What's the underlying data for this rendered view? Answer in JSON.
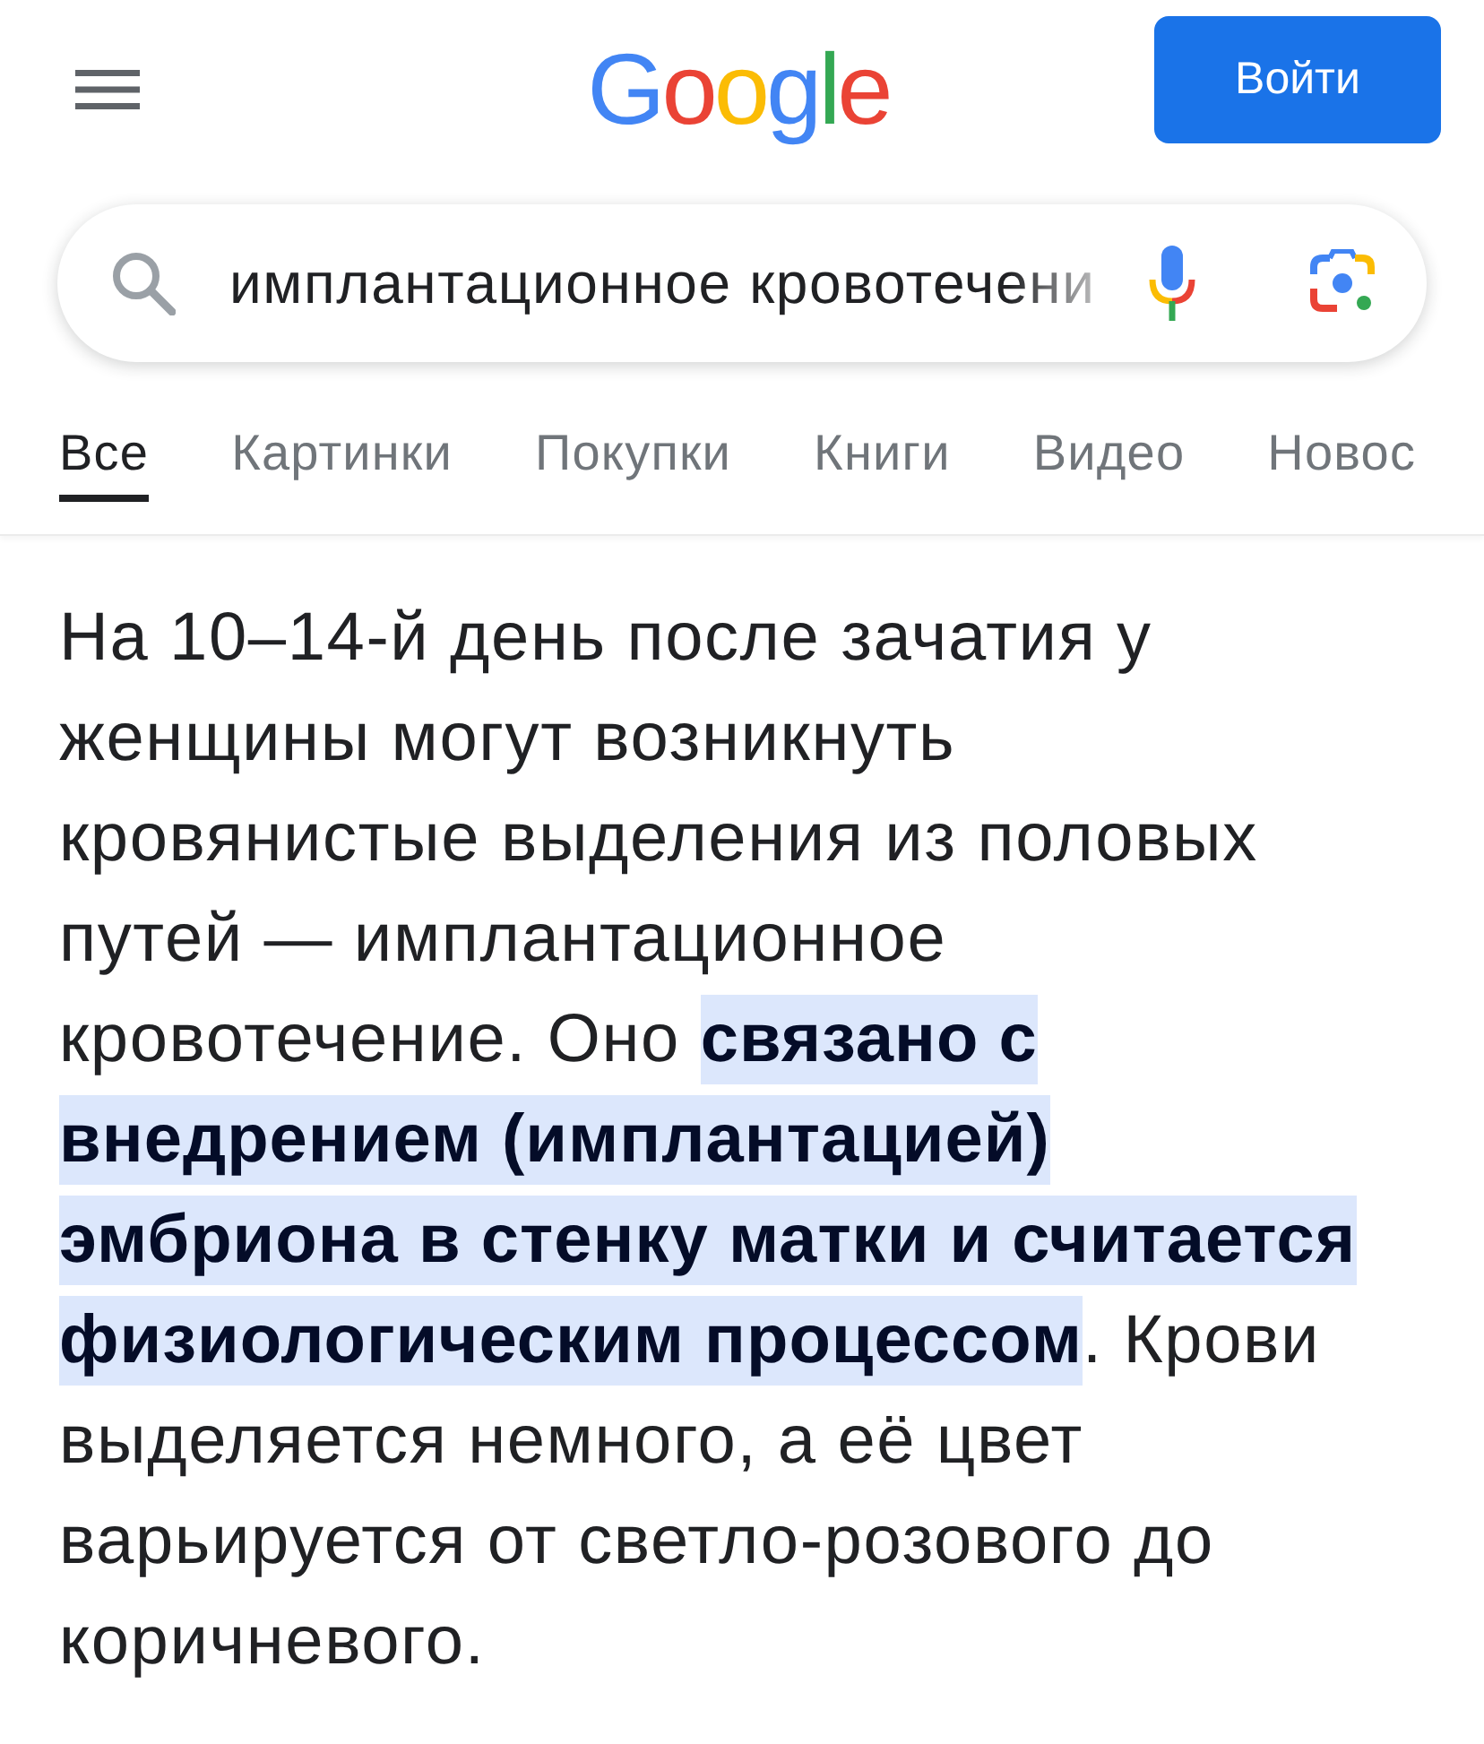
{
  "header": {
    "logo": "Google",
    "sign_in_button": "Войти"
  },
  "search": {
    "value": "имплантационное кровотечени"
  },
  "tabs": [
    {
      "label": "Все",
      "selected": true
    },
    {
      "label": "Картинки",
      "selected": false
    },
    {
      "label": "Покупки",
      "selected": false
    },
    {
      "label": "Книги",
      "selected": false
    },
    {
      "label": "Видео",
      "selected": false
    },
    {
      "label": "Новос",
      "selected": false
    }
  ],
  "answer": {
    "text": "На 10–14-й день после зачатия у женщины могут возникнуть кровянистые выделения из половых путей — имплантационное кровотечение. Оно **связано с внедрением (имплантацией) эмбриона в стенку матки и считается физиологическим процессом**. Крови выделяется немного, а её цвет варьируется от светло-розового до коричневого."
  }
}
